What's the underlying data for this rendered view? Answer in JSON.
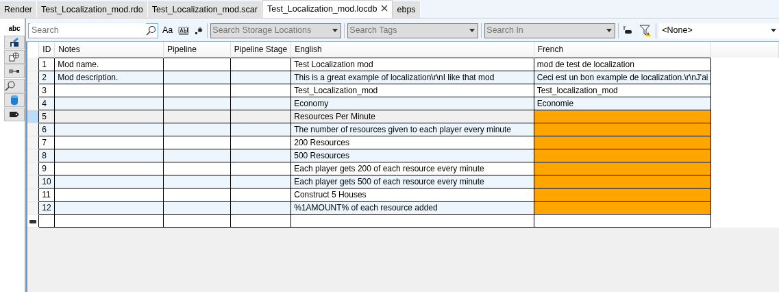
{
  "tabs": [
    {
      "label": "Render",
      "selected": false
    },
    {
      "label": "Test_Localization_mod.rdo",
      "selected": false
    },
    {
      "label": "Test_Localization_mod.scar",
      "selected": false
    },
    {
      "label": "Test_Localization_mod.locdb",
      "selected": true
    },
    {
      "label": "ebps",
      "selected": false
    }
  ],
  "side_tabs": [
    {
      "kind": "text",
      "label": "abc",
      "selected": true
    },
    {
      "kind": "edit",
      "selected": false
    },
    {
      "kind": "globe",
      "selected": false
    },
    {
      "kind": "link",
      "selected": false
    },
    {
      "kind": "search",
      "selected": false
    },
    {
      "kind": "database",
      "selected": false
    },
    {
      "kind": "tag",
      "selected": false
    }
  ],
  "toolbar": {
    "search": {
      "placeholder": "Search"
    },
    "match_case": "Aa",
    "storage": {
      "placeholder": "Search Storage Locations"
    },
    "tags": {
      "placeholder": "Search Tags"
    },
    "search_in": {
      "placeholder": "Search In"
    },
    "filter_value": "<None>"
  },
  "table": {
    "columns": [
      "ID",
      "Notes",
      "Pipeline",
      "Pipeline Stage",
      "English",
      "French"
    ],
    "rows": [
      {
        "cells": [
          "1",
          "Mod name.",
          "",
          "",
          "Test Localization mod",
          "mod de test de localization"
        ],
        "missing": false,
        "selected": false
      },
      {
        "cells": [
          "2",
          "Mod description.",
          "",
          "",
          "This is a great example of localization\\r\\nI like that mod",
          "Ceci est un bon example de localization.\\r\\nJ'ai"
        ],
        "missing": false,
        "selected": false
      },
      {
        "cells": [
          "3",
          "",
          "",
          "",
          "Test_Localization_mod",
          "Test_localization_mod"
        ],
        "missing": false,
        "selected": false
      },
      {
        "cells": [
          "4",
          "",
          "",
          "",
          "Economy",
          "Economie"
        ],
        "missing": false,
        "selected": false
      },
      {
        "cells": [
          "5",
          "",
          "",
          "",
          "Resources Per Minute",
          ""
        ],
        "missing": true,
        "selected": true
      },
      {
        "cells": [
          "6",
          "",
          "",
          "",
          "The number of resources given to each player every minute",
          ""
        ],
        "missing": true,
        "selected": false
      },
      {
        "cells": [
          "7",
          "",
          "",
          "",
          "200 Resources",
          ""
        ],
        "missing": true,
        "selected": false
      },
      {
        "cells": [
          "8",
          "",
          "",
          "",
          "500 Resources",
          ""
        ],
        "missing": true,
        "selected": false
      },
      {
        "cells": [
          "9",
          "",
          "",
          "",
          "Each player gets 200 of each resource every minute",
          ""
        ],
        "missing": true,
        "selected": false
      },
      {
        "cells": [
          "10",
          "",
          "",
          "",
          "Each player gets 500 of each resource every minute",
          ""
        ],
        "missing": true,
        "selected": false
      },
      {
        "cells": [
          "11",
          "",
          "",
          "",
          "Construct 5 Houses",
          ""
        ],
        "missing": true,
        "selected": false
      },
      {
        "cells": [
          "12",
          "",
          "",
          "",
          "%1AMOUNT% of each resource added",
          ""
        ],
        "missing": true,
        "selected": false
      }
    ]
  }
}
